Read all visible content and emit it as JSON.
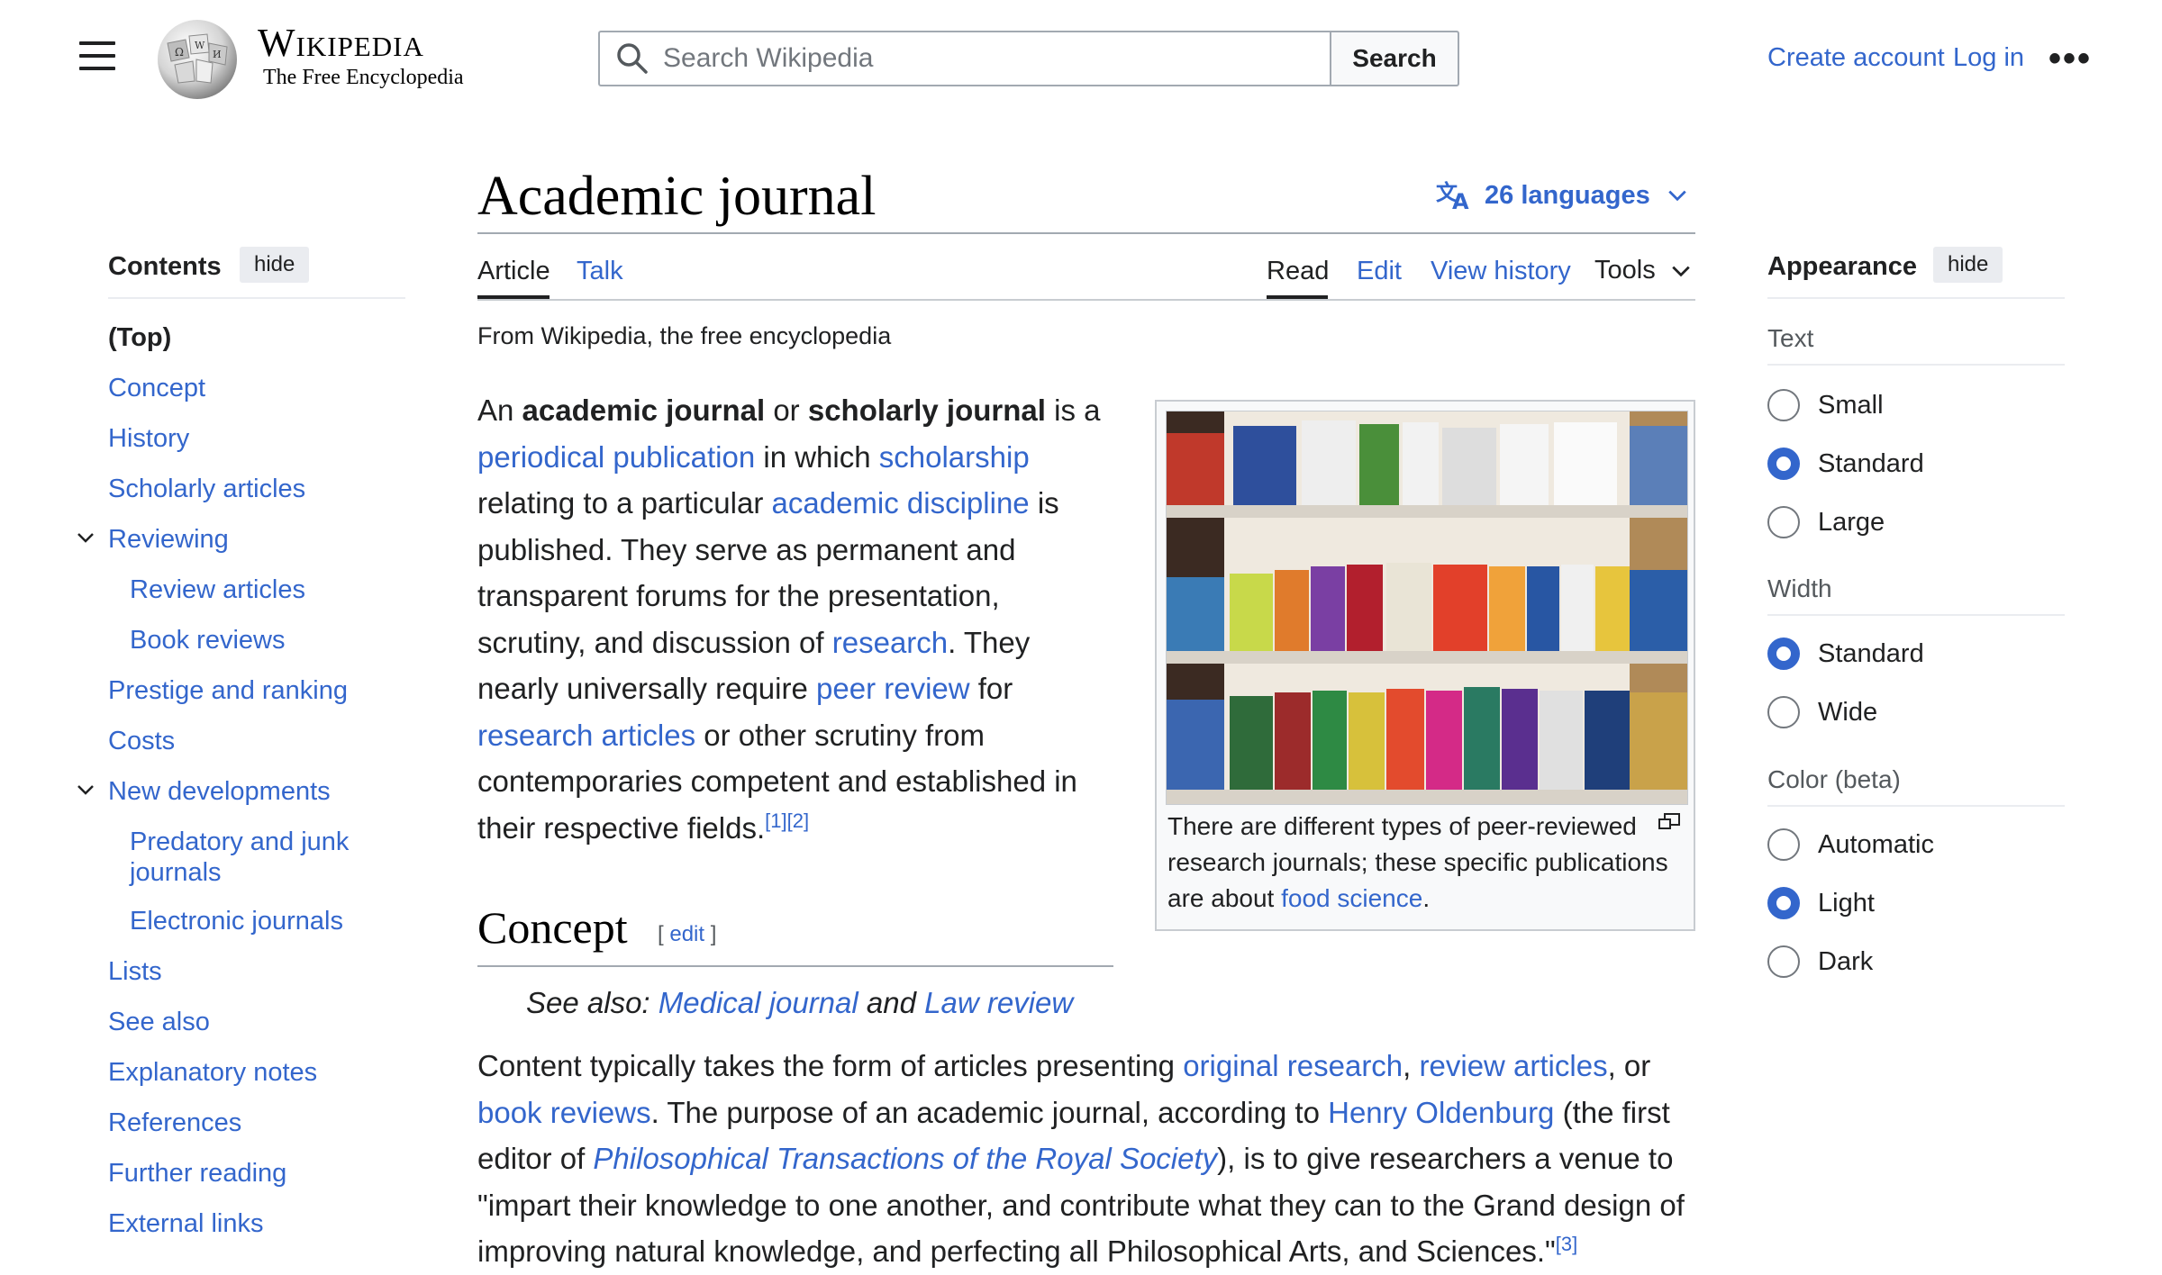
{
  "header": {
    "wordmark": "Wikipedia",
    "tagline": "The Free Encyclopedia",
    "search_placeholder": "Search Wikipedia",
    "search_button": "Search",
    "create_account": "Create account",
    "log_in": "Log in",
    "more": "•••"
  },
  "toc": {
    "title": "Contents",
    "hide": "hide",
    "items": [
      {
        "label": "(Top)"
      },
      {
        "label": "Concept"
      },
      {
        "label": "History"
      },
      {
        "label": "Scholarly articles"
      },
      {
        "label": "Reviewing"
      },
      {
        "label": "Review articles"
      },
      {
        "label": "Book reviews"
      },
      {
        "label": "Prestige and ranking"
      },
      {
        "label": "Costs"
      },
      {
        "label": "New developments"
      },
      {
        "label": "Predatory and junk journals"
      },
      {
        "label": "Electronic journals"
      },
      {
        "label": "Lists"
      },
      {
        "label": "See also"
      },
      {
        "label": "Explanatory notes"
      },
      {
        "label": "References"
      },
      {
        "label": "Further reading"
      },
      {
        "label": "External links"
      }
    ]
  },
  "article": {
    "title": "Academic journal",
    "languages": "26 languages",
    "tabs": {
      "article": "Article",
      "talk": "Talk",
      "read": "Read",
      "edit": "Edit",
      "history": "View history",
      "tools": "Tools"
    },
    "from": "From Wikipedia, the free encyclopedia",
    "lead": {
      "t1": "An ",
      "b1": "academic journal",
      "t2": " or ",
      "b2": "scholarly journal",
      "t3": " is a ",
      "l1": "periodical publication",
      "t4": " in which ",
      "l2": "scholarship",
      "t5": " relating to a particular ",
      "l3": "academic discipline",
      "t6": " is published. They serve as permanent and transparent forums for the presentation, scrutiny, and discussion of ",
      "l4": "research",
      "t7": ". They nearly universally require ",
      "l5": "peer review",
      "t8": " for ",
      "l6": "research articles",
      "t9": " or other scrutiny from contemporaries competent and established in their respective fields.",
      "r1": "[1]",
      "r2": "[2]"
    },
    "figure": {
      "caption_text": "There are different types of peer-reviewed research journals; these specific publications are about ",
      "caption_link": "food science",
      "caption_end": "."
    },
    "concept": {
      "heading": "Concept",
      "edit": "[ edit ]",
      "see_also_prefix": "See also: ",
      "see_also_1": "Medical journal",
      "see_also_and": " and ",
      "see_also_2": "Law review",
      "p_t1": "Content typically takes the form of articles presenting ",
      "p_l1": "original research",
      "p_t2": ", ",
      "p_l2": "review articles",
      "p_t3": ", or ",
      "p_l3": "book reviews",
      "p_t4": ". The purpose of an academic journal, according to ",
      "p_l4": "Henry Oldenburg",
      "p_t5": " (the first editor of ",
      "p_l5": "Philosophical Transactions of the Royal Society",
      "p_t6": "), is to give researchers a venue to \"impart their knowledge to one another, and contribute what they can to the Grand design of improving natural knowledge, and perfecting all Philosophical Arts, and Sciences.\"",
      "p_ref": "[3]"
    }
  },
  "appearance": {
    "title": "Appearance",
    "hide": "hide",
    "text_label": "Text",
    "text_options": [
      "Small",
      "Standard",
      "Large"
    ],
    "text_selected": "Standard",
    "width_label": "Width",
    "width_options": [
      "Standard",
      "Wide"
    ],
    "width_selected": "Standard",
    "color_label": "Color (beta)",
    "color_options": [
      "Automatic",
      "Light",
      "Dark"
    ],
    "color_selected": "Light"
  },
  "colors": {
    "link": "#3366cc",
    "text": "#202122",
    "accent": "#3366cc"
  }
}
